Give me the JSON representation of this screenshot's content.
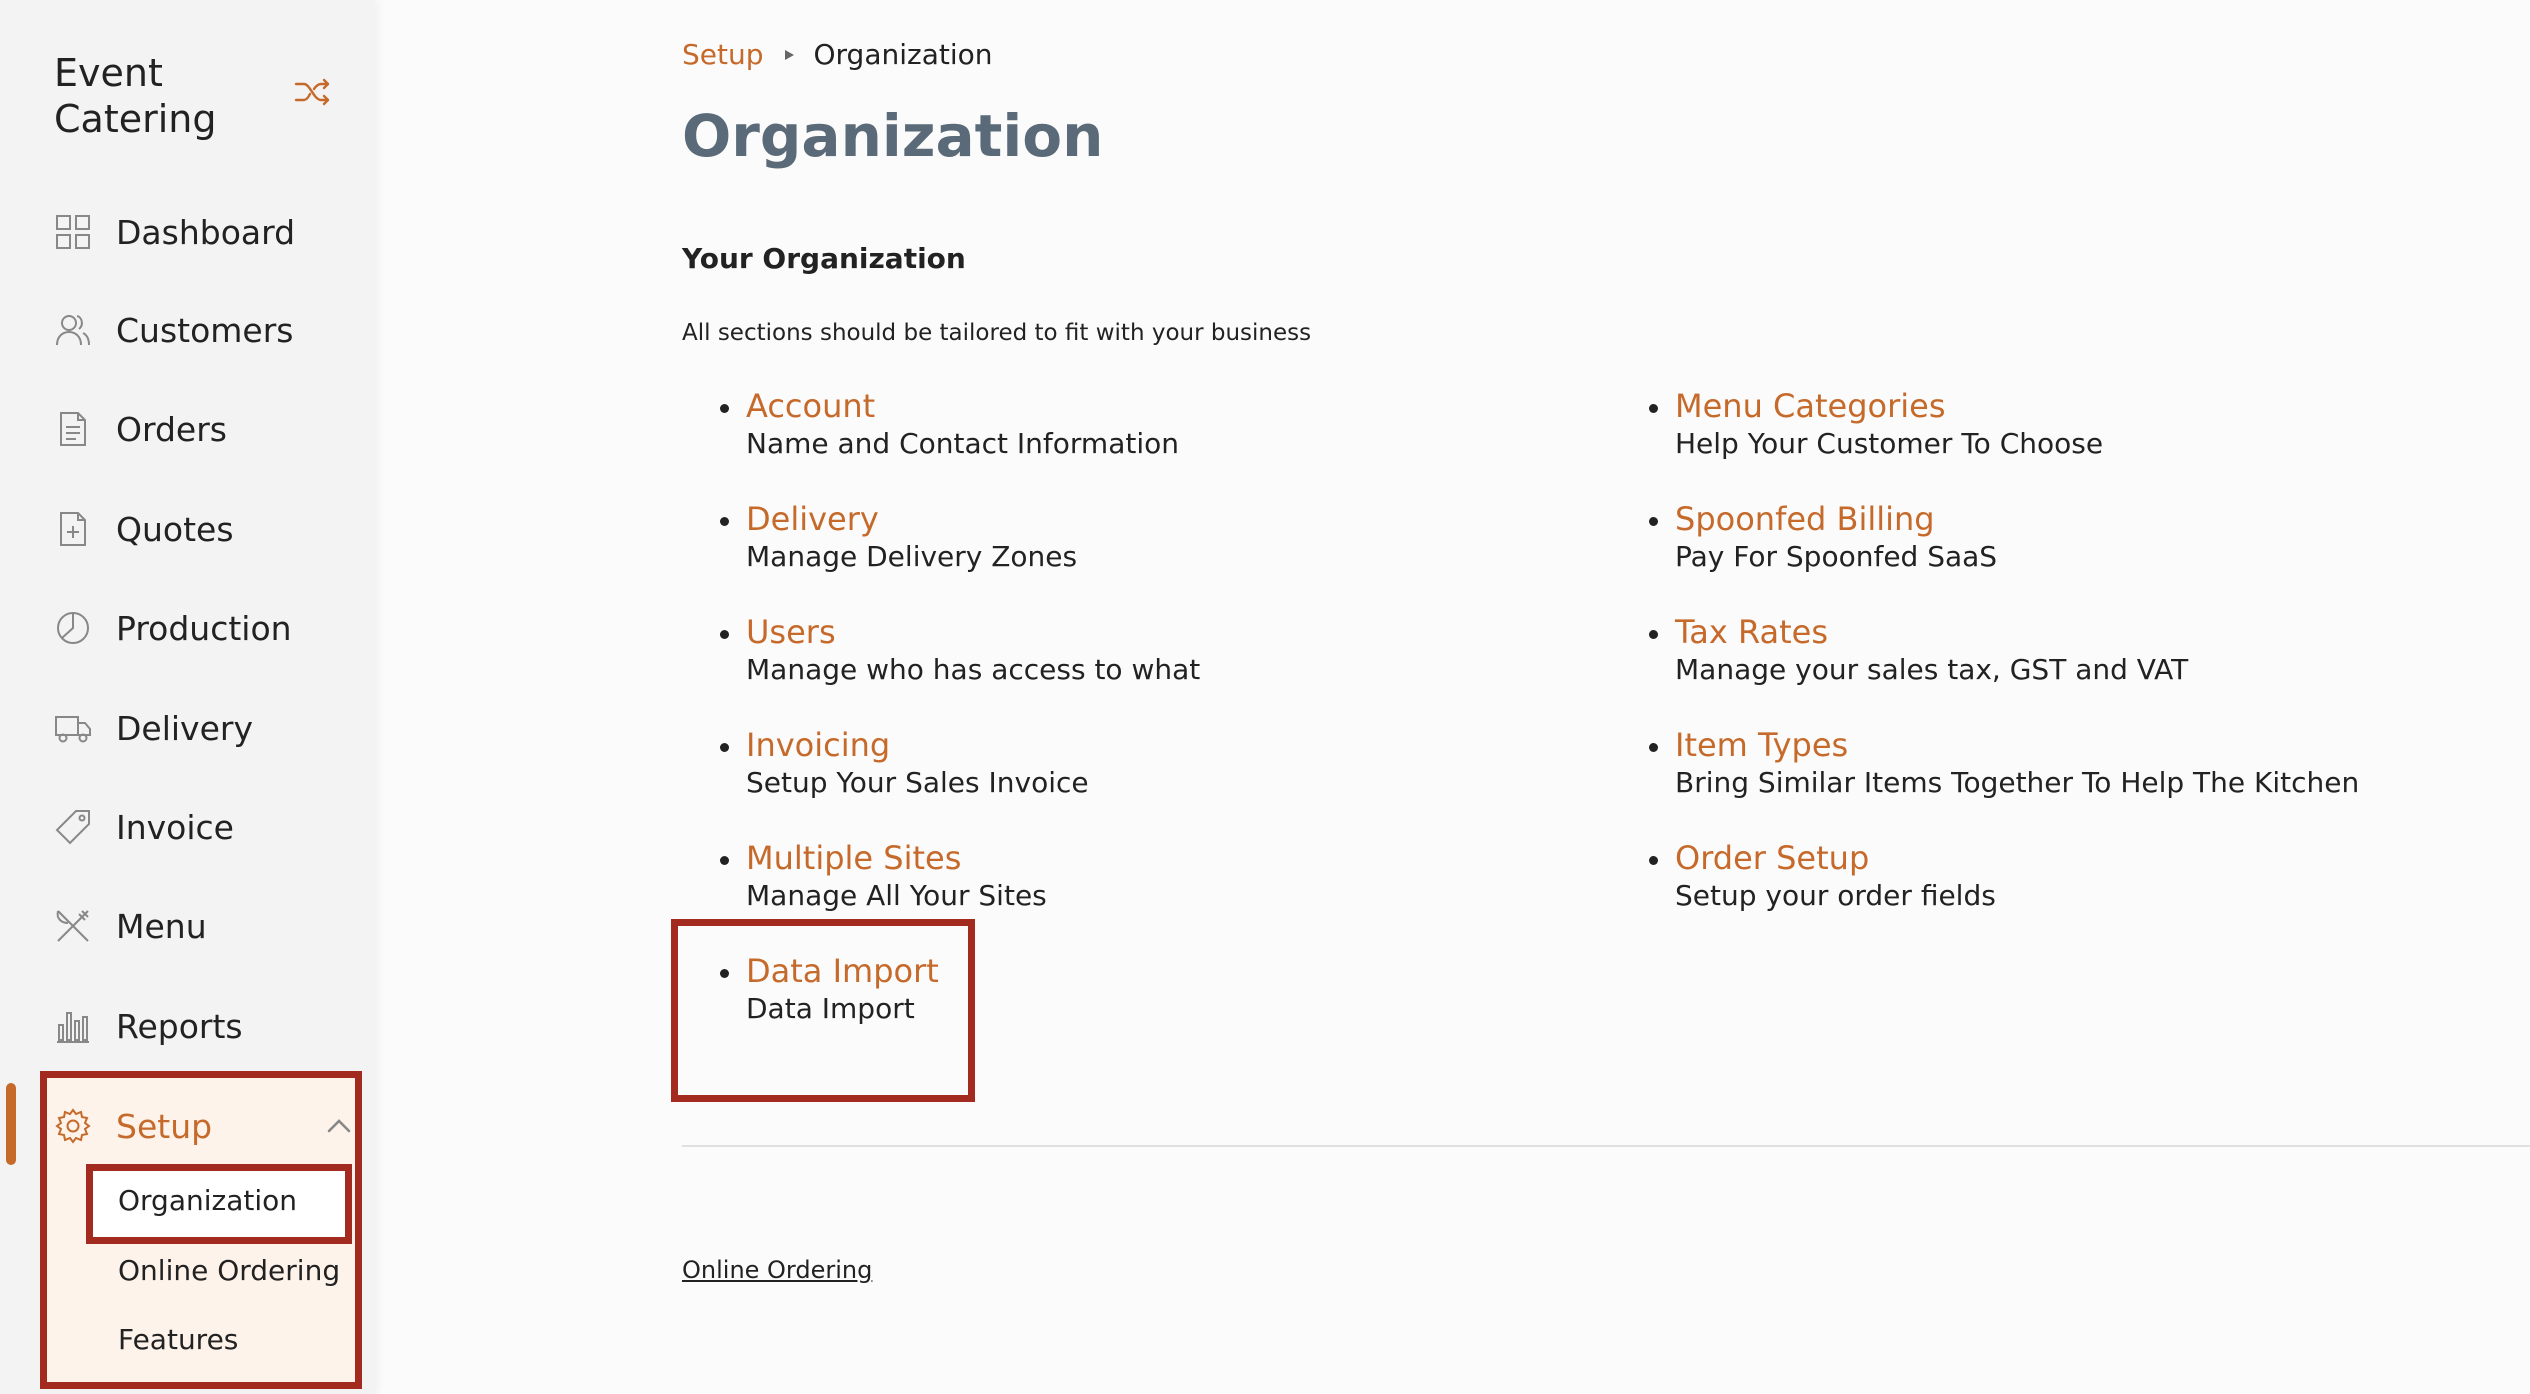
{
  "brand": {
    "line1": "Event",
    "line2": "Catering"
  },
  "icons": {
    "brand_action": "shuffle-icon"
  },
  "colors": {
    "accent": "#c66a2b",
    "highlight": "#a32a1f",
    "title": "#5a6a78"
  },
  "sidebar": {
    "items": [
      {
        "label": "Dashboard",
        "icon": "dashboard-icon"
      },
      {
        "label": "Customers",
        "icon": "customers-icon"
      },
      {
        "label": "Orders",
        "icon": "orders-icon"
      },
      {
        "label": "Quotes",
        "icon": "quotes-icon"
      },
      {
        "label": "Production",
        "icon": "production-icon"
      },
      {
        "label": "Delivery",
        "icon": "delivery-truck-icon"
      },
      {
        "label": "Invoice",
        "icon": "invoice-tag-icon"
      },
      {
        "label": "Menu",
        "icon": "menu-utensils-icon"
      },
      {
        "label": "Reports",
        "icon": "reports-icon"
      }
    ],
    "setup": {
      "label": "Setup",
      "icon": "gear-icon",
      "sub_items": [
        "Organization",
        "Online Ordering",
        "Features"
      ]
    }
  },
  "breadcrumb": {
    "parent": "Setup",
    "current": "Organization"
  },
  "page": {
    "title": "Organization",
    "section_title": "Your Organization",
    "section_subtitle": "All sections should be tailored to fit with your business"
  },
  "left_links": [
    {
      "title": "Account",
      "desc": "Name and Contact Information"
    },
    {
      "title": "Delivery",
      "desc": "Manage Delivery Zones"
    },
    {
      "title": "Users",
      "desc": "Manage who has access to what"
    },
    {
      "title": "Invoicing",
      "desc": "Setup Your Sales Invoice"
    },
    {
      "title": "Multiple Sites",
      "desc": "Manage All Your Sites"
    },
    {
      "title": "Data Import",
      "desc": "Data Import"
    }
  ],
  "right_links": [
    {
      "title": "Menu Categories",
      "desc": "Help Your Customer To Choose"
    },
    {
      "title": "Spoonfed Billing",
      "desc": "Pay For Spoonfed SaaS"
    },
    {
      "title": "Tax Rates",
      "desc": "Manage your sales tax, GST and VAT"
    },
    {
      "title": "Item Types",
      "desc": "Bring Similar Items Together To Help The Kitchen"
    },
    {
      "title": "Order Setup",
      "desc": "Setup your order fields"
    }
  ],
  "footer": {
    "link": "Online Ordering"
  }
}
